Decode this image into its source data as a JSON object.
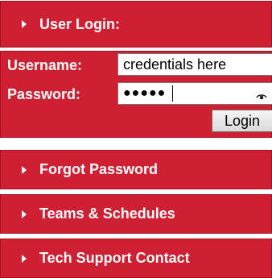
{
  "header": {
    "title": "User Login:"
  },
  "login": {
    "username_label": "Username:",
    "username_value": "credentials here",
    "password_label": "Password:",
    "password_value": "●●●●●",
    "login_button": "Login"
  },
  "nav": {
    "items": [
      {
        "label": "Forgot Password"
      },
      {
        "label": "Teams & Schedules"
      },
      {
        "label": "Tech Support Contact"
      }
    ]
  },
  "colors": {
    "panel": "#cf1f32",
    "text": "#ffffff"
  },
  "icons": {
    "arrow": "right-triangle-icon",
    "password_reveal": "eye-icon"
  }
}
